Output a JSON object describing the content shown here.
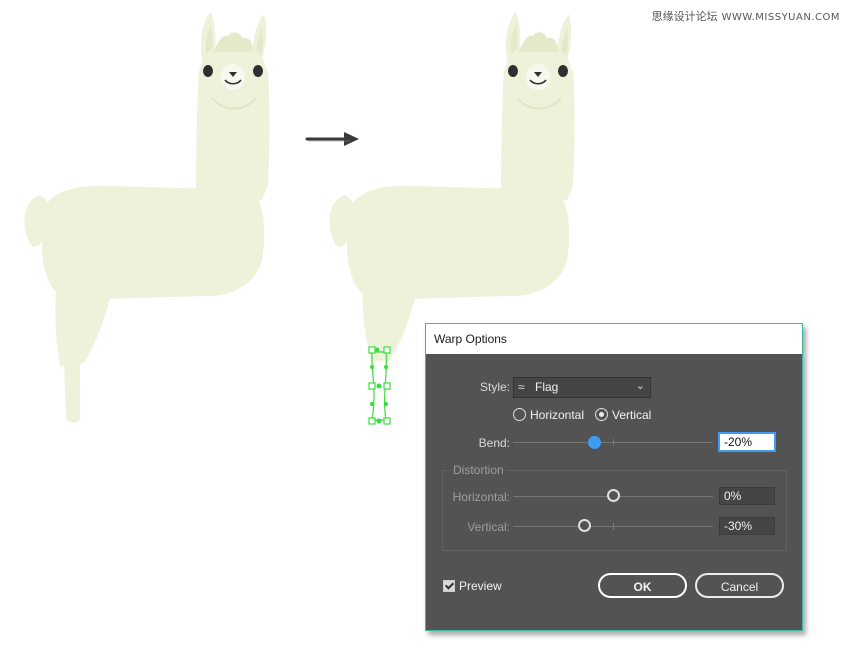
{
  "watermark": {
    "text": "思缘设计论坛",
    "site": "WWW.MISSYUAN.COM"
  },
  "colors": {
    "llama_body": "#eef2db",
    "llama_face": "#e5ebcc",
    "selection": "#3ddc3d",
    "dialog_bg": "#535353",
    "dialog_border": "#3fb5a6",
    "accent": "#3f9cf3"
  },
  "canvas": {
    "arrow_icon": "right-arrow-icon"
  },
  "dialog": {
    "title": "Warp Options",
    "style_label": "Style:",
    "style_value": "Flag",
    "style_icon": "flag-icon",
    "orientation": {
      "horizontal_label": "Horizontal",
      "vertical_label": "Vertical",
      "selected": "Vertical"
    },
    "bend": {
      "label": "Bend:",
      "value": "-20%",
      "percent": -20
    },
    "distortion": {
      "title": "Distortion",
      "horizontal": {
        "label": "Horizontal:",
        "value": "0%",
        "percent": 0
      },
      "vertical": {
        "label": "Vertical:",
        "value": "-30%",
        "percent": -30
      }
    },
    "preview": {
      "label": "Preview",
      "checked": true
    },
    "ok_label": "OK",
    "cancel_label": "Cancel"
  }
}
